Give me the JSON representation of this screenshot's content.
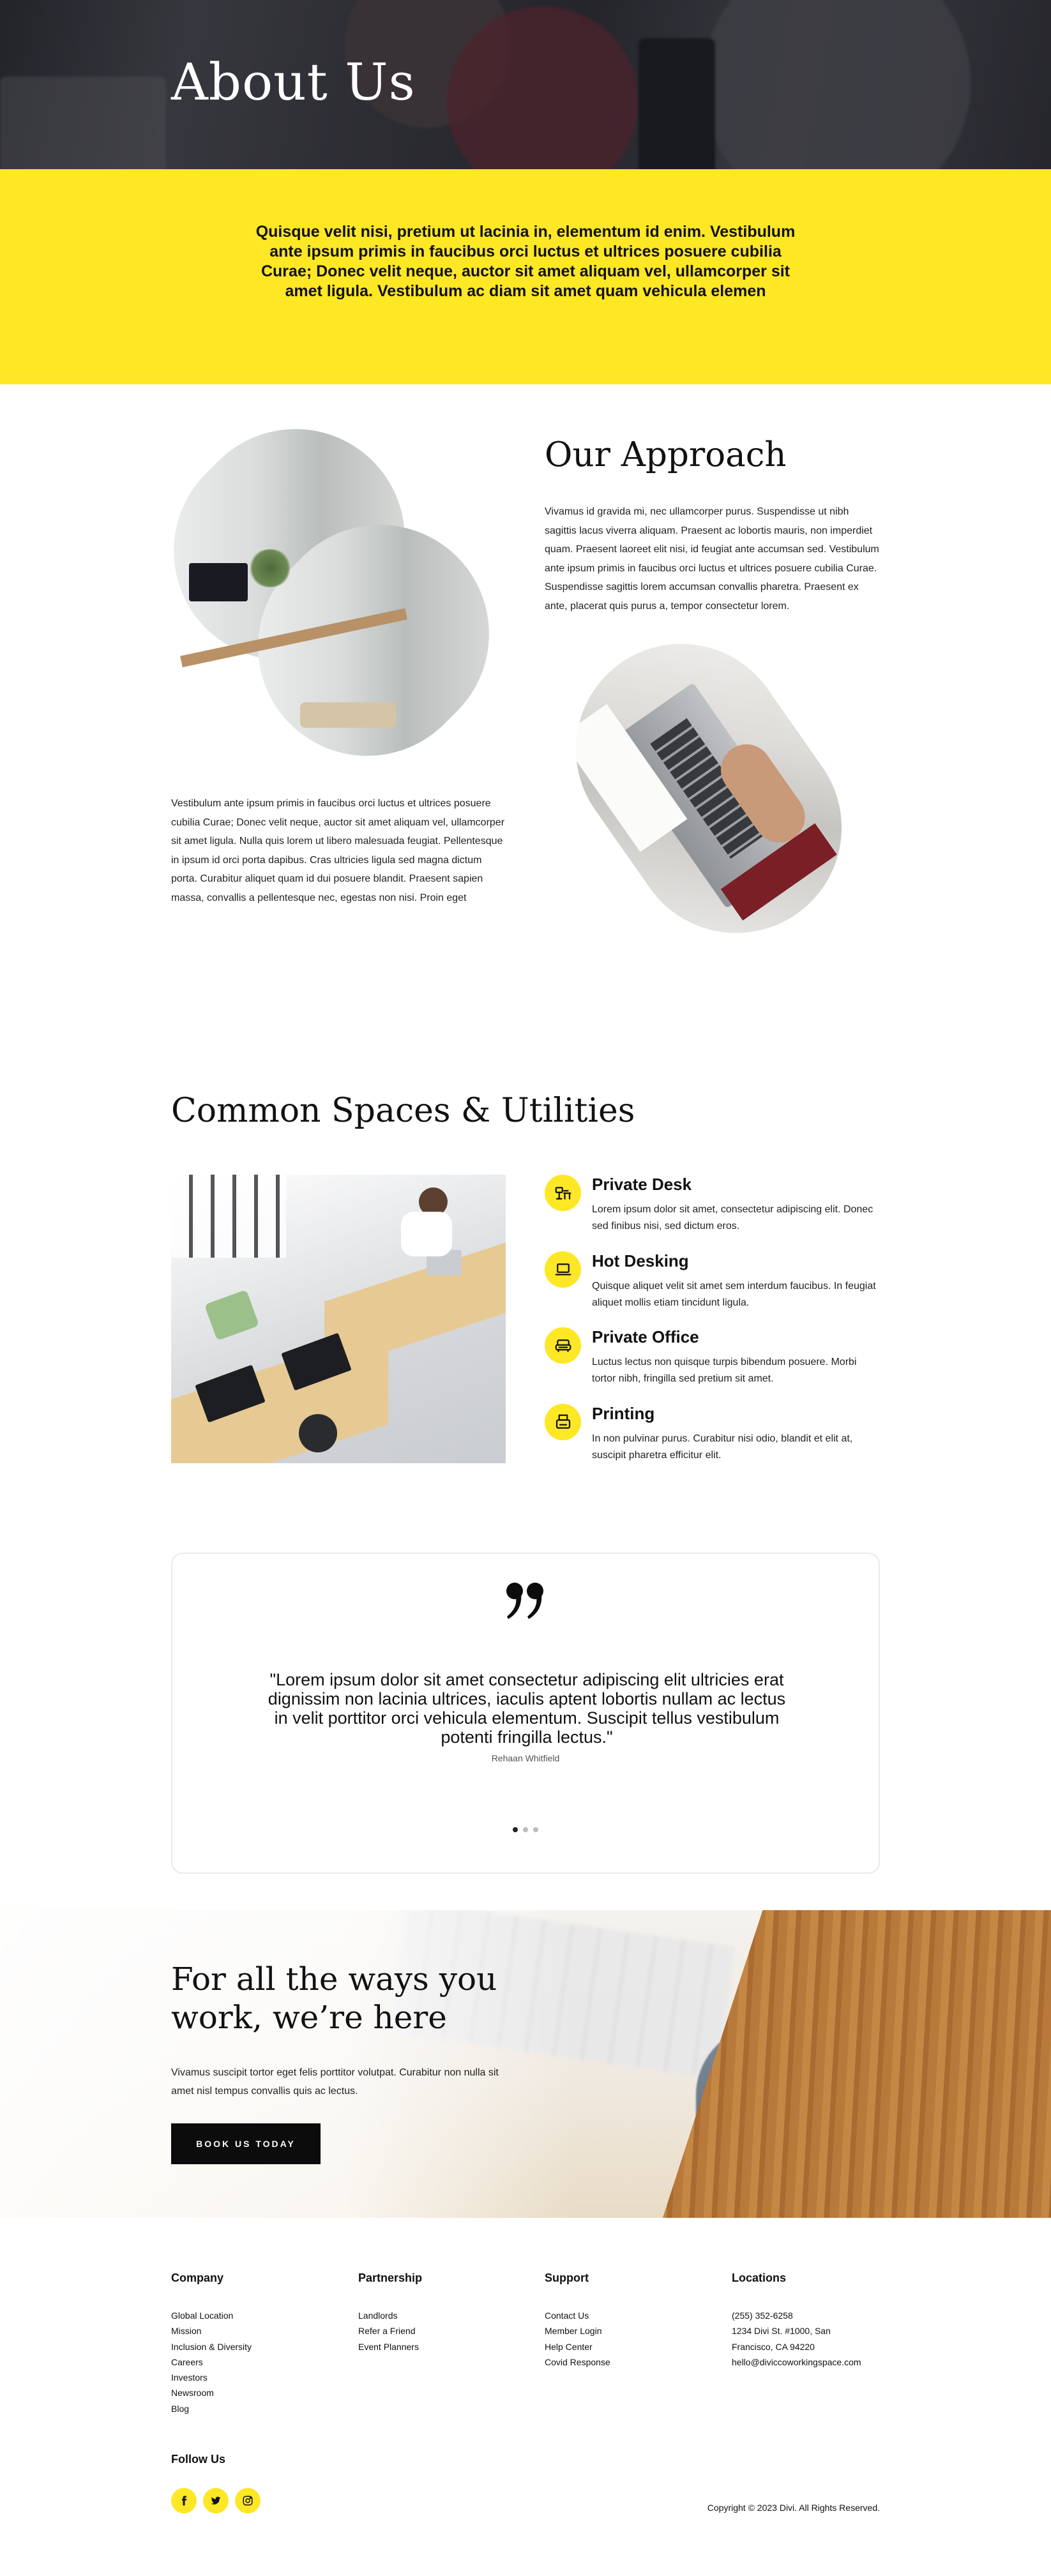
{
  "hero": {
    "title": "About Us"
  },
  "intro": {
    "text": "Quisque velit nisi, pretium ut lacinia in, elementum id enim. Vestibulum ante ipsum primis in faucibus orci luctus et ultrices posuere cubilia Curae; Donec velit neque, auctor sit amet aliquam vel, ullamcorper sit amet ligula. Vestibulum ac diam sit amet quam vehicula elemen"
  },
  "approach": {
    "title": "Our Approach",
    "body_right": "Vivamus id gravida mi, nec ullamcorper purus. Suspendisse ut nibh sagittis lacus viverra aliquam. Praesent ac lobortis mauris, non imperdiet quam. Praesent laoreet elit nisi, id feugiat ante accumsan sed. Vestibulum ante ipsum primis in faucibus orci luctus et ultrices posuere cubilia Curae. Suspendisse sagittis lorem accumsan convallis pharetra. Praesent ex ante, placerat quis purus a, tempor consectetur lorem.",
    "body_left": "Vestibulum ante ipsum primis in faucibus orci luctus et ultrices posuere cubilia Curae; Donec velit neque, auctor sit amet aliquam vel, ullamcorper sit amet ligula. Nulla quis lorem ut libero malesuada feugiat. Pellentesque in ipsum id orci porta dapibus. Cras ultricies ligula sed magna dictum porta. Curabitur aliquet quam id dui posuere blandit. Praesent sapien massa, convallis a pellentesque nec, egestas non nisi. Proin eget"
  },
  "spaces": {
    "title": "Common Spaces & Utilities",
    "features": [
      {
        "icon": "desk-chair-icon",
        "title": "Private Desk",
        "text": "Lorem ipsum dolor sit amet, consectetur adipiscing elit. Donec sed finibus nisi, sed dictum eros."
      },
      {
        "icon": "laptop-icon",
        "title": "Hot Desking",
        "text": "Quisque aliquet velit sit amet sem interdum faucibus. In feugiat aliquet mollis etiam tincidunt ligula."
      },
      {
        "icon": "sofa-icon",
        "title": "Private Office",
        "text": "Luctus lectus non quisque turpis bibendum posuere. Morbi tortor nibh, fringilla sed pretium sit amet."
      },
      {
        "icon": "printer-icon",
        "title": "Printing",
        "text": "In non pulvinar purus. Curabitur nisi odio, blandit et elit at, suscipit pharetra efficitur elit."
      }
    ]
  },
  "testimonial": {
    "quote": "\"Lorem ipsum dolor sit amet consectetur adipiscing elit ultricies erat dignissim non lacinia ultrices, iaculis aptent lobortis nullam ac lectus in velit porttitor orci vehicula elementum. Suscipit tellus vestibulum potenti fringilla lectus.\"",
    "author": "Rehaan Whitfield",
    "slides": 3,
    "active_slide": 1
  },
  "cta": {
    "title": "For all the ways you work, we’re here",
    "text": "Vivamus suscipit tortor eget felis porttitor volutpat. Curabitur non nulla sit amet nisl tempus convallis quis ac lectus.",
    "button": "BOOK US TODAY"
  },
  "footer": {
    "columns": [
      {
        "title": "Company",
        "links": [
          "Global Location",
          "Mission",
          "Inclusion & Diversity",
          "Careers",
          "Investors",
          "Newsroom",
          "Blog"
        ]
      },
      {
        "title": "Partnership",
        "links": [
          "Landlords",
          "Refer a Friend",
          "Event Planners"
        ]
      },
      {
        "title": "Support",
        "links": [
          "Contact Us",
          "Member Login",
          "Help Center",
          "Covid Response"
        ]
      },
      {
        "title": "Locations",
        "links": [
          "(255) 352-6258",
          "1234 Divi St. #1000, San",
          "Francisco, CA 94220",
          "hello@diviccoworkingspace.com"
        ]
      }
    ],
    "follow_title": "Follow Us",
    "socials": [
      "facebook-icon",
      "twitter-icon",
      "instagram-icon"
    ],
    "copyright": "Copyright © 2023 Divi. All Rights Reserved."
  },
  "colors": {
    "accent": "#fee725",
    "dark": "#0c0c0c",
    "text": "#111111"
  }
}
